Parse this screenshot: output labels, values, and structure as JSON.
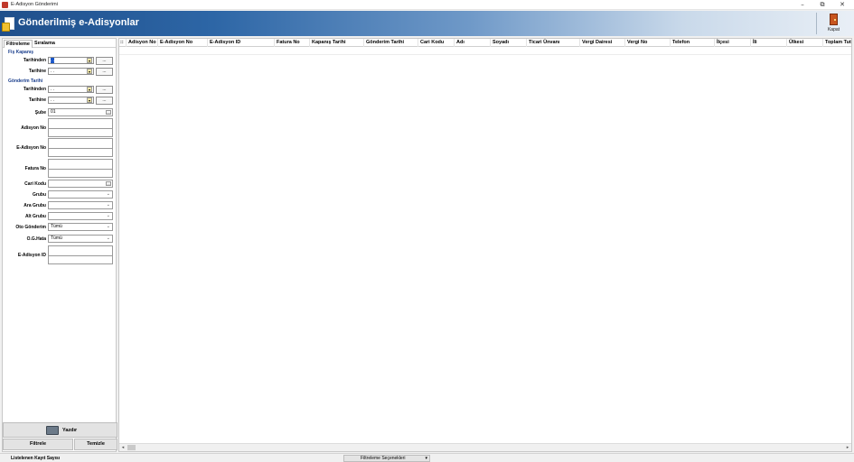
{
  "window": {
    "title": "E-Adisyon Gönderimi",
    "min": "–",
    "restore": "⧉",
    "close": "✕"
  },
  "header": {
    "title": "Gönderilmiş e-Adisyonlar",
    "close_label": "Kapat"
  },
  "tabs": [
    "Filtreleme",
    "Sıralama"
  ],
  "filters": {
    "fis_kapanis": {
      "group": "Fiş Kapanış",
      "from_label": "Tarihinden",
      "to_label": "Tarihine",
      "from_value": ". .",
      "to_value": ". .",
      "btn": "..."
    },
    "gonderim": {
      "group": "Gönderim Tarihi",
      "from_label": "Tarihinden",
      "to_label": "Tarihine",
      "from_value": ". .",
      "to_value": ". .",
      "btn": "..."
    },
    "sube_label": "Şube",
    "sube_value": "01",
    "adisyon_no_label": "Adisyon No",
    "e_adisyon_no_label": "E-Adisyon No",
    "fatura_no_label": "Fatura No",
    "cari_kodu_label": "Cari Kodu",
    "grubu_label": "Grubu",
    "ara_grubu_label": "Ara Grubu",
    "alt_grubu_label": "Alt Grubu",
    "oto_gonderim_label": "Oto Gönderim",
    "oto_gonderim_value": "Tümü",
    "og_hata_label": "O.G.Hata",
    "og_hata_value": "Tümü",
    "e_adisyon_id_label": "E-Adisyon ID",
    "dots": "...",
    "chevron": "⌄"
  },
  "buttons": {
    "print": "Yazdır",
    "filter": "Filtrele",
    "clear": "Temizle"
  },
  "grid": {
    "row_marker": "::",
    "columns": [
      "Adisyon No",
      "E-Adisyon No",
      "E-Adisyon ID",
      "Fatura No",
      "Kapanış Tarihi",
      "Gönderim Tarihi",
      "Cari Kodu",
      "Adı",
      "Soyadı",
      "Ticari Ünvanı",
      "Vergi Dairesi",
      "Vergi No",
      "Telefon",
      "İlçesi",
      "İli",
      "Ülkesi",
      "Toplam Tut"
    ]
  },
  "scroll": {
    "left": "◂",
    "right": "▸"
  },
  "status": {
    "count_label": "Listelenen Kayıt Sayısı",
    "filter_options": "Filtreleme Seçenekleri",
    "dropdown": "▾"
  }
}
